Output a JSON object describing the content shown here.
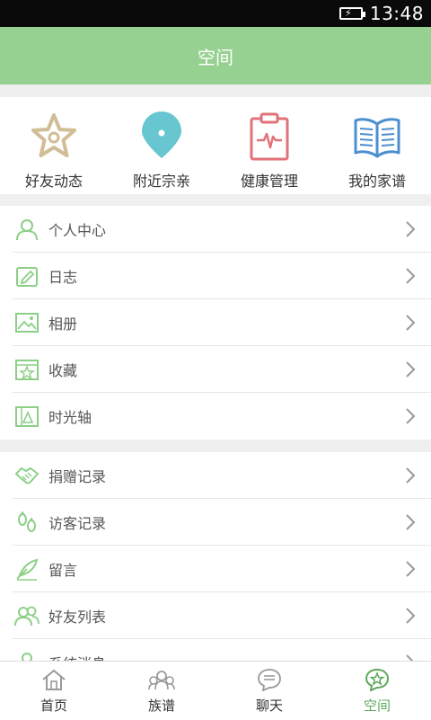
{
  "status": {
    "time": "13:48"
  },
  "header": {
    "title": "空间"
  },
  "quick_tiles": [
    {
      "label": "好友动态",
      "icon": "star-icon"
    },
    {
      "label": "附近宗亲",
      "icon": "location-pin-icon"
    },
    {
      "label": "健康管理",
      "icon": "health-clipboard-icon"
    },
    {
      "label": "我的家谱",
      "icon": "book-icon"
    }
  ],
  "menu_group_1": [
    {
      "label": "个人中心",
      "icon": "person-icon"
    },
    {
      "label": "日志",
      "icon": "journal-icon"
    },
    {
      "label": "相册",
      "icon": "photo-album-icon"
    },
    {
      "label": "收藏",
      "icon": "favorites-icon"
    },
    {
      "label": "时光轴",
      "icon": "timeline-icon"
    }
  ],
  "menu_group_2": [
    {
      "label": "捐赠记录",
      "icon": "handshake-icon"
    },
    {
      "label": "访客记录",
      "icon": "footprints-icon"
    },
    {
      "label": "留言",
      "icon": "quill-icon"
    },
    {
      "label": "好友列表",
      "icon": "friends-icon"
    },
    {
      "label": "系统消息",
      "icon": "system-message-icon"
    }
  ],
  "bottom_nav": [
    {
      "label": "首页",
      "icon": "home-icon"
    },
    {
      "label": "族谱",
      "icon": "family-tree-icon"
    },
    {
      "label": "聊天",
      "icon": "chat-icon"
    },
    {
      "label": "空间",
      "icon": "space-icon",
      "active": true
    }
  ],
  "colors": {
    "header_green": "#97d191",
    "icon_green": "#8ccf86",
    "active_green": "#5fa85a",
    "star_tan": "#d1bd96",
    "pin_teal": "#67c6cf",
    "clipboard_red": "#e2727a",
    "book_blue": "#4c8fd0"
  }
}
